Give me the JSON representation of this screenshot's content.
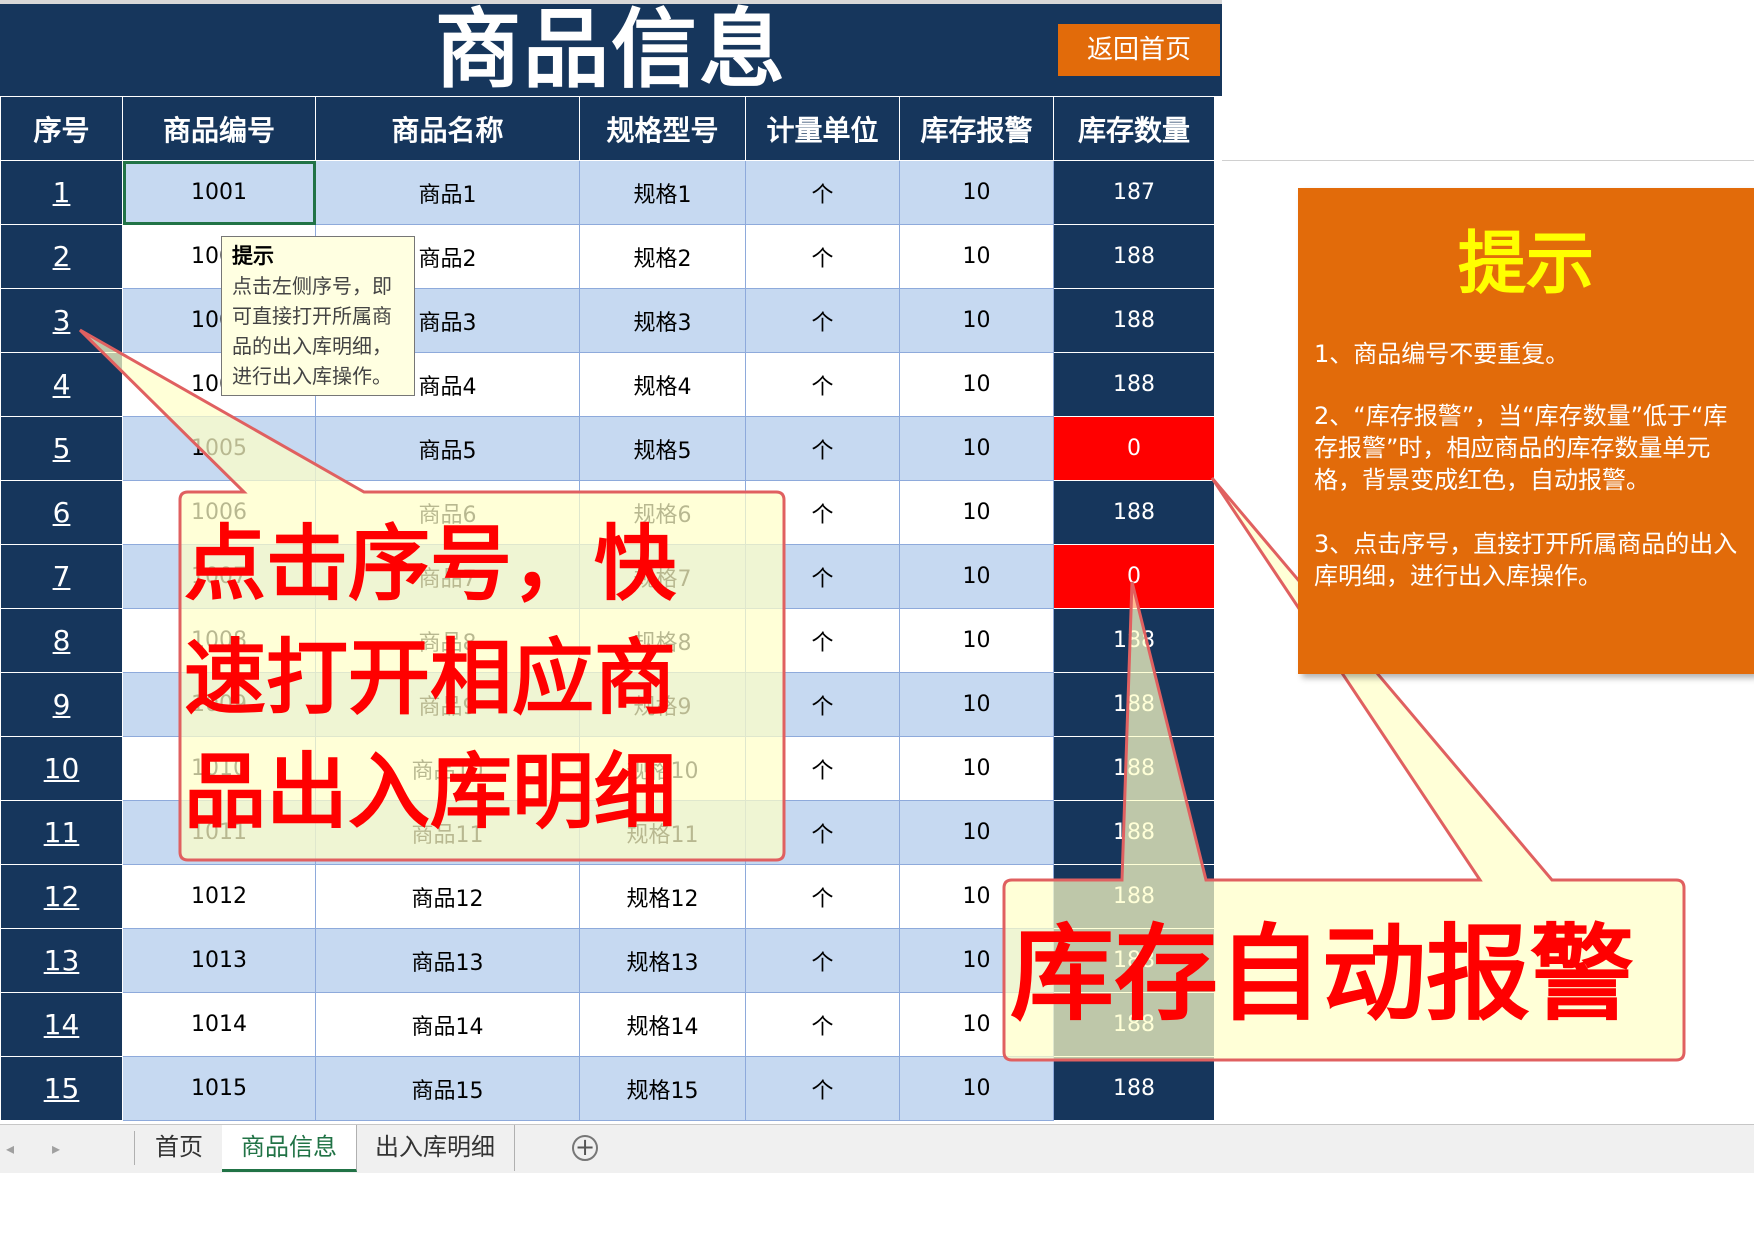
{
  "title": "商品信息",
  "return_button": "返回首页",
  "table": {
    "headers": [
      "序号",
      "商品编号",
      "商品名称",
      "规格型号",
      "计量单位",
      "库存报警",
      "库存数量"
    ],
    "rows": [
      {
        "seq": "1",
        "code": "1001",
        "name": "商品1",
        "spec": "规格1",
        "unit": "个",
        "alarm": "10",
        "qty": "187"
      },
      {
        "seq": "2",
        "code": "1002",
        "name": "商品2",
        "spec": "规格2",
        "unit": "个",
        "alarm": "10",
        "qty": "188"
      },
      {
        "seq": "3",
        "code": "1003",
        "name": "商品3",
        "spec": "规格3",
        "unit": "个",
        "alarm": "10",
        "qty": "188"
      },
      {
        "seq": "4",
        "code": "1004",
        "name": "商品4",
        "spec": "规格4",
        "unit": "个",
        "alarm": "10",
        "qty": "188"
      },
      {
        "seq": "5",
        "code": "1005",
        "name": "商品5",
        "spec": "规格5",
        "unit": "个",
        "alarm": "10",
        "qty": "0"
      },
      {
        "seq": "6",
        "code": "1006",
        "name": "商品6",
        "spec": "规格6",
        "unit": "个",
        "alarm": "10",
        "qty": "188"
      },
      {
        "seq": "7",
        "code": "1007",
        "name": "商品7",
        "spec": "规格7",
        "unit": "个",
        "alarm": "10",
        "qty": "0"
      },
      {
        "seq": "8",
        "code": "1008",
        "name": "商品8",
        "spec": "规格8",
        "unit": "个",
        "alarm": "10",
        "qty": "188"
      },
      {
        "seq": "9",
        "code": "1009",
        "name": "商品9",
        "spec": "规格9",
        "unit": "个",
        "alarm": "10",
        "qty": "188"
      },
      {
        "seq": "10",
        "code": "1010",
        "name": "商品10",
        "spec": "规格10",
        "unit": "个",
        "alarm": "10",
        "qty": "188"
      },
      {
        "seq": "11",
        "code": "1011",
        "name": "商品11",
        "spec": "规格11",
        "unit": "个",
        "alarm": "10",
        "qty": "188"
      },
      {
        "seq": "12",
        "code": "1012",
        "name": "商品12",
        "spec": "规格12",
        "unit": "个",
        "alarm": "10",
        "qty": "188"
      },
      {
        "seq": "13",
        "code": "1013",
        "name": "商品13",
        "spec": "规格13",
        "unit": "个",
        "alarm": "10",
        "qty": "188"
      },
      {
        "seq": "14",
        "code": "1014",
        "name": "商品14",
        "spec": "规格14",
        "unit": "个",
        "alarm": "10",
        "qty": "188"
      },
      {
        "seq": "15",
        "code": "1015",
        "name": "商品15",
        "spec": "规格15",
        "unit": "个",
        "alarm": "10",
        "qty": "188"
      }
    ]
  },
  "comment": {
    "title": "提示",
    "lines": [
      "点击左侧序号，即",
      "可直接打开所属商",
      "品的出入库明细，",
      "进行出入库操作。"
    ]
  },
  "callout_left": [
    "点击序号，快",
    "速打开相应商",
    "品出入库明细"
  ],
  "callout_right": "库存自动报警",
  "tip": {
    "title": "提示",
    "items": [
      "1、商品编号不要重复。",
      "2、“库存报警”，当“库存数量”低于“库存报警”时，相应商品的库存数量单元格，背景变成红色，自动报警。",
      "3、点击序号，直接打开所属商品的出入库明细，进行出入库操作。"
    ]
  },
  "sheet_tabs": [
    "首页",
    "商品信息",
    "出入库明细"
  ],
  "active_tab": "商品信息",
  "colors": {
    "header_bg": "#16365c",
    "row_alt_bg": "#c6d9f1",
    "alert_red": "#ff0000",
    "accent_orange": "#e26b0a",
    "callout_fill": "#ffffc8",
    "tip_title": "#ffff00",
    "excel_green": "#217346"
  }
}
